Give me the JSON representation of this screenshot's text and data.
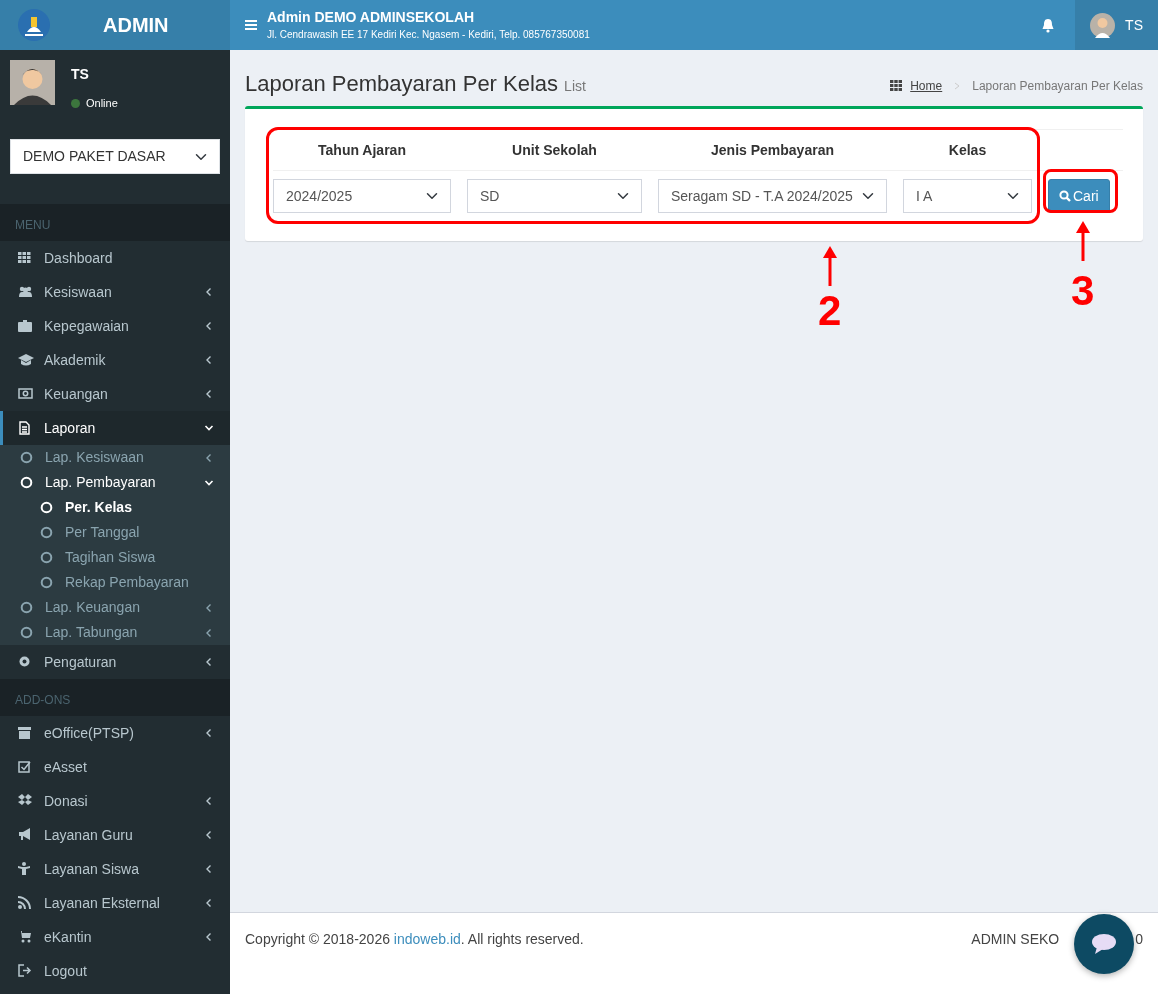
{
  "brand": {
    "title": "ADMIN"
  },
  "topbar": {
    "title": "Admin DEMO ADMINSEKOLAH",
    "address": "Jl. Cendrawasih EE 17 Kediri Kec. Ngasem - Kediri, Telp. 085767350081",
    "user": "TS"
  },
  "user_panel": {
    "name": "TS",
    "status": "Online"
  },
  "package_select": {
    "value": "DEMO PAKET DASAR"
  },
  "sidebar": [
    {
      "kind": "header",
      "label": "MENU"
    },
    {
      "kind": "link",
      "label": "Dashboard",
      "selected": false
    },
    {
      "kind": "menu",
      "label": "Kesiswaan",
      "selected": false,
      "expanded": false
    },
    {
      "kind": "menu",
      "label": "Kepegawaian",
      "selected": false,
      "expanded": false
    },
    {
      "kind": "menu",
      "label": "Akademik",
      "selected": false,
      "expanded": false
    },
    {
      "kind": "menu",
      "label": "Keuangan",
      "selected": false,
      "expanded": false
    },
    {
      "kind": "menu",
      "label": "Laporan",
      "selected": true,
      "expanded": true,
      "children": [
        {
          "kind": "menu",
          "label": "Lap. Kesiswaan",
          "selected": false,
          "expanded": false
        },
        {
          "kind": "menu",
          "label": "Lap. Pembayaran",
          "selected": true,
          "expanded": true,
          "children": [
            {
              "kind": "link",
              "label": "Per. Kelas",
              "selected": true
            },
            {
              "kind": "link",
              "label": "Per Tanggal",
              "selected": false
            },
            {
              "kind": "link",
              "label": "Tagihan Siswa",
              "selected": false
            },
            {
              "kind": "link",
              "label": "Rekap Pembayaran",
              "selected": false
            }
          ]
        },
        {
          "kind": "menu",
          "label": "Lap. Keuangan",
          "selected": false,
          "expanded": false
        },
        {
          "kind": "menu",
          "label": "Lap. Tabungan",
          "selected": false,
          "expanded": false
        }
      ]
    },
    {
      "kind": "menu",
      "label": "Pengaturan",
      "selected": false,
      "expanded": false
    },
    {
      "kind": "header",
      "label": "ADD-ONS"
    },
    {
      "kind": "menu",
      "label": "eOffice(PTSP)",
      "selected": false,
      "expanded": false
    },
    {
      "kind": "link",
      "label": "eAsset",
      "selected": false
    },
    {
      "kind": "menu",
      "label": "Donasi",
      "selected": false,
      "expanded": false
    },
    {
      "kind": "menu",
      "label": "Layanan Guru",
      "selected": false,
      "expanded": false
    },
    {
      "kind": "menu",
      "label": "Layanan Siswa",
      "selected": false,
      "expanded": false
    },
    {
      "kind": "menu",
      "label": "Layanan Eksternal",
      "selected": false,
      "expanded": false
    },
    {
      "kind": "menu",
      "label": "eKantin",
      "selected": false,
      "expanded": false
    },
    {
      "kind": "link",
      "label": "Logout",
      "selected": false
    }
  ],
  "page": {
    "title": "Laporan Pembayaran Per Kelas",
    "subtitle": "List"
  },
  "breadcrumb": [
    {
      "label": "Home"
    },
    {
      "label": "Laporan Pembayaran Per Kelas"
    }
  ],
  "filters": [
    {
      "label": "Tahun Ajaran",
      "value": "2024/2025"
    },
    {
      "label": "Unit Sekolah",
      "value": "SD"
    },
    {
      "label": "Jenis Pembayaran",
      "value": "Seragam SD - T.A 2024/2025"
    },
    {
      "label": "Kelas",
      "value": "I A"
    }
  ],
  "search_button": {
    "label": "Cari"
  },
  "annotations": [
    {
      "label": "2"
    },
    {
      "label": "3"
    }
  ],
  "footer": {
    "copyright_before": "Copyright © 2018-2026 ",
    "link": "indoweb.id",
    "copyright_after": ". All rights reserved.",
    "right_start": "ADMIN SEKO",
    "right_end": "0"
  }
}
